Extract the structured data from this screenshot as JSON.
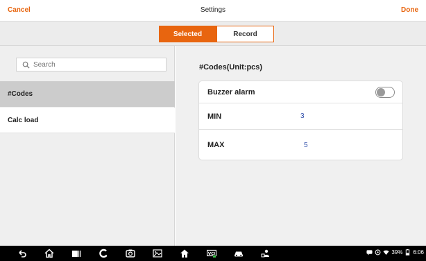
{
  "topbar": {
    "cancel": "Cancel",
    "title": "Settings",
    "done": "Done"
  },
  "tabs": [
    {
      "label": "Selected",
      "active": true
    },
    {
      "label": "Record",
      "active": false
    }
  ],
  "search": {
    "placeholder": "Search"
  },
  "list": [
    {
      "label": "#Codes",
      "selected": true
    },
    {
      "label": "Calc load",
      "selected": false
    }
  ],
  "detail": {
    "title": "#Codes(Unit:pcs)",
    "buzzer_label": "Buzzer alarm",
    "buzzer_on": false,
    "min_label": "MIN",
    "min_value": "3",
    "max_label": "MAX",
    "max_value": "5"
  },
  "navbar": {
    "icons": [
      "back-icon",
      "home-icon",
      "recent-apps-icon",
      "browser-icon",
      "camera-icon",
      "screenshot-icon",
      "vci-home-icon",
      "vci-icon",
      "car-icon",
      "user-icon"
    ]
  },
  "status": {
    "battery": "39%",
    "time": "6:06"
  },
  "colors": {
    "accent": "#e8650f",
    "value": "#2b4aa8",
    "selected_row": "#cccccc"
  }
}
